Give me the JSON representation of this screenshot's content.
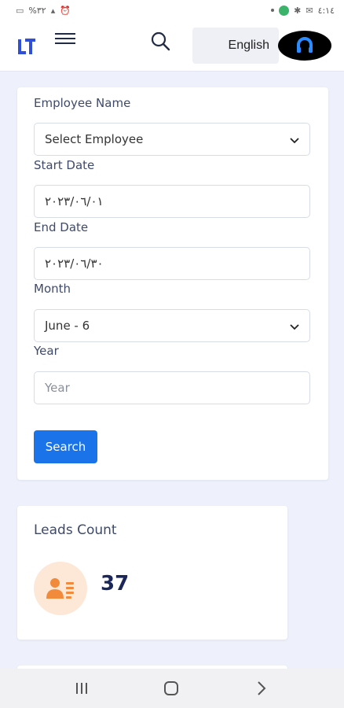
{
  "status_bar": {
    "left_text": "%٣٢",
    "right_text": "٤:١٤"
  },
  "header": {
    "language_label": "English"
  },
  "form": {
    "employee_label": "Employee Name",
    "employee_value": "Select Employee",
    "start_date_label": "Start Date",
    "start_date_value": "٢٠٢٣/٠٦/٠١",
    "end_date_label": "End Date",
    "end_date_value": "٢٠٢٣/٠٦/٣٠",
    "month_label": "Month",
    "month_value": "June - 6",
    "year_label": "Year",
    "year_placeholder": "Year",
    "search_label": "Search"
  },
  "leads": {
    "title": "Leads Count",
    "count": "37"
  },
  "colors": {
    "primary": "#1a73e8",
    "logo": "#2f4fd8",
    "leads_icon": "#f28a3c"
  }
}
